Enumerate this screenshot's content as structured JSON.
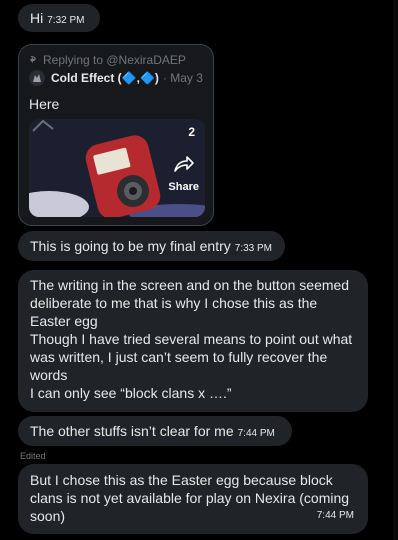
{
  "messages": {
    "m1": {
      "text": "Hi",
      "time": "7:32 PM"
    },
    "reply": {
      "replying_to": "Replying to @NexiraDAEP",
      "author": "Cold Effect (🔷,🔷)",
      "date": "· May 3",
      "text": "Here",
      "media": {
        "count": "2",
        "share_label": "Share"
      }
    },
    "m2": {
      "text": "This is going to be my final entry",
      "time": "7:33 PM"
    },
    "m3": {
      "line1": "The writing in the screen and on the button seemed",
      "line2": "deliberate to me that is why I chose this as the",
      "line3": "Easter egg",
      "line4": "Though I have tried several means to point out what",
      "line5": "was written, I just can’t seem to fully recover the",
      "line6": "words",
      "line7": "I can only see “block clans x ….”"
    },
    "m4": {
      "text": "The other stuffs isn’t clear for me",
      "time": "7:44 PM"
    },
    "edited_label": "Edited",
    "m5": {
      "line1": "But I chose this as the Easter egg because block",
      "line2": "clans is not yet available for play on Nexira (coming",
      "line3": "soon)",
      "time": "7:44 PM"
    }
  },
  "colors": {
    "background": "#000000",
    "bubble": "#202327",
    "muted": "#71767b",
    "text": "#e7e9ea"
  },
  "icons": [
    "reply-arrow-icon",
    "avatar",
    "share-icon"
  ]
}
